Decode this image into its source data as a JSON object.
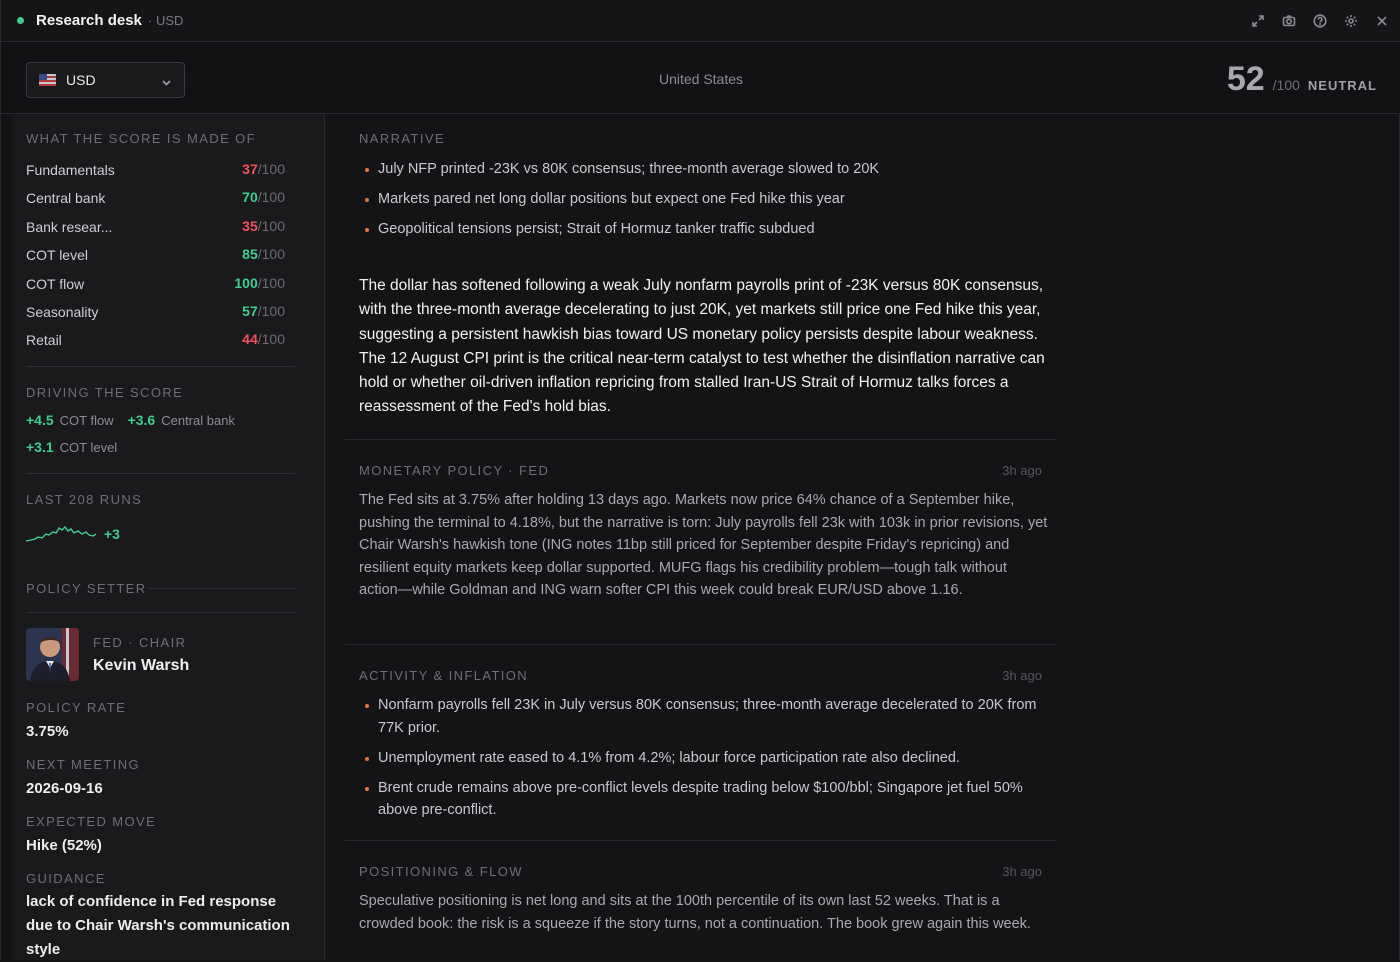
{
  "titlebar": {
    "title": "Research desk",
    "subtitle": "· USD",
    "icons": [
      "expand-icon",
      "camera-icon",
      "help-icon",
      "gear-icon",
      "close-icon"
    ]
  },
  "header": {
    "currency": "USD",
    "country": "United States",
    "score": "52",
    "score_max": "/100",
    "score_label": "NEUTRAL"
  },
  "sidebar": {
    "composition_title": "WHAT THE SCORE IS MADE OF",
    "components": [
      {
        "name": "Fundamentals",
        "value": "37",
        "max": "/100",
        "tone": "red"
      },
      {
        "name": "Central bank",
        "value": "70",
        "max": "/100",
        "tone": "green"
      },
      {
        "name": "Bank resear...",
        "value": "35",
        "max": "/100",
        "tone": "red"
      },
      {
        "name": "COT level",
        "value": "85",
        "max": "/100",
        "tone": "green"
      },
      {
        "name": "COT flow",
        "value": "100",
        "max": "/100",
        "tone": "green"
      },
      {
        "name": "Seasonality",
        "value": "57",
        "max": "/100",
        "tone": "green"
      },
      {
        "name": "Retail",
        "value": "44",
        "max": "/100",
        "tone": "red"
      }
    ],
    "drivers_title": "DRIVING THE SCORE",
    "drivers": [
      {
        "value": "+4.5",
        "label": "COT flow"
      },
      {
        "value": "+3.6",
        "label": "Central bank"
      },
      {
        "value": "+3.1",
        "label": "COT level"
      }
    ],
    "runs_title": "LAST 208 RUNS",
    "runs_delta": "+3",
    "policy_title": "POLICY SETTER",
    "policy_setter": {
      "role": "FED · CHAIR",
      "name": "Kevin Warsh",
      "rate_label": "POLICY RATE",
      "rate": "3.75%",
      "meeting_label": "NEXT MEETING",
      "meeting": "2026-09-16",
      "move_label": "EXPECTED MOVE",
      "move": "Hike (52%)",
      "guidance_label": "GUIDANCE",
      "guidance": "lack of confidence in Fed response due to Chair Warsh's communication style"
    },
    "colors": {
      "positive": "#3ecf8e",
      "negative": "#f0545b"
    }
  },
  "main": {
    "narrative": {
      "title": "NARRATIVE",
      "bullets": [
        "July NFP printed -23K vs 80K consensus; three-month average slowed to 20K",
        "Markets pared net long dollar positions but expect one Fed hike this year",
        "Geopolitical tensions persist; Strait of Hormuz tanker traffic subdued"
      ],
      "summary": "The dollar has softened following a weak July nonfarm payrolls print of -23K versus 80K consensus, with the three-month average decelerating to just 20K, yet markets still price one Fed hike this year, suggesting a persistent hawkish bias toward US monetary policy persists despite labour weakness. The 12 August CPI print is the critical near-term catalyst to test whether the disinflation narrative can hold or whether oil-driven inflation repricing from stalled Iran-US Strait of Hormuz talks forces a reassessment of the Fed's hold bias."
    },
    "monetary": {
      "title": "MONETARY POLICY · FED",
      "time": "3h ago",
      "body": "The Fed sits at 3.75% after holding 13 days ago. Markets now price 64% chance of a September hike, pushing the terminal to 4.18%, but the narrative is torn: July payrolls fell 23k with 103k in prior revisions, yet Chair Warsh's hawkish tone (ING notes 11bp still priced for September despite Friday's repricing) and resilient equity markets keep dollar supported. MUFG flags his credibility problem—tough talk without action—while Goldman and ING warn softer CPI this week could break EUR/USD above 1.16."
    },
    "activity": {
      "title": "ACTIVITY & INFLATION",
      "time": "3h ago",
      "bullets": [
        "Nonfarm payrolls fell 23K in July versus 80K consensus; three-month average decelerated to 20K from 77K prior.",
        "Unemployment rate eased to 4.1% from 4.2%; labour force participation rate also declined.",
        "Brent crude remains above pre-conflict levels despite trading below $100/bbl; Singapore jet fuel 50% above pre-conflict."
      ]
    },
    "positioning": {
      "title": "POSITIONING & FLOW",
      "time": "3h ago",
      "body": "Speculative positioning is net long and sits at the 100th percentile of its own last 52 weeks. That is a crowded book: the risk is a squeeze if the story turns, not a continuation. The book grew again this week."
    }
  }
}
